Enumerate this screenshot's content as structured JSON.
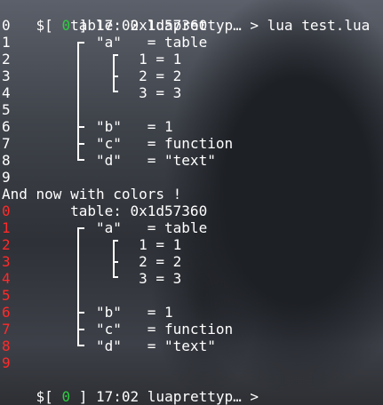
{
  "terminal": {
    "prompt1": {
      "open": "$[ ",
      "code": "0",
      "close": " ] ",
      "time": "17:02",
      "sep": " ",
      "host": "luaprettyp… > ",
      "command": "lua test.lua"
    },
    "block1": [
      {
        "n": "0",
        "text": "       table: 0x1d57360"
      },
      {
        "n": "1",
        "text": "          \"a\"   = table"
      },
      {
        "n": "2",
        "text": "               1 = 1"
      },
      {
        "n": "3",
        "text": "               2 = 2"
      },
      {
        "n": "4",
        "text": "               3 = 3"
      },
      {
        "n": "5",
        "text": ""
      },
      {
        "n": "6",
        "text": "          \"b\"   = 1"
      },
      {
        "n": "7",
        "text": "          \"c\"   = function"
      },
      {
        "n": "8",
        "text": "          \"d\"   = \"text\""
      },
      {
        "n": "9",
        "text": ""
      }
    ],
    "message": "And now with colors !",
    "block2": [
      {
        "n": "0",
        "text": "       table: 0x1d57360"
      },
      {
        "n": "1",
        "text": "          \"a\"   = table"
      },
      {
        "n": "2",
        "text": "               1 = 1"
      },
      {
        "n": "3",
        "text": "               2 = 2"
      },
      {
        "n": "4",
        "text": "               3 = 3"
      },
      {
        "n": "5",
        "text": ""
      },
      {
        "n": "6",
        "text": "          \"b\"   = 1"
      },
      {
        "n": "7",
        "text": "          \"c\"   = function"
      },
      {
        "n": "8",
        "text": "          \"d\"   = \"text\""
      },
      {
        "n": "9",
        "text": ""
      }
    ],
    "prompt2": {
      "open": "$[ ",
      "code": "0",
      "close": " ] ",
      "time": "17:02",
      "sep": " ",
      "host": "luaprettyp… > ",
      "command": ""
    }
  },
  "colors": {
    "foreground": "#ffffff",
    "status_ok": "#2ecc40",
    "gutter": "#ff2a2a",
    "outer_bracket": "#ff2a2a",
    "inner_bracket": "#ffd400"
  }
}
